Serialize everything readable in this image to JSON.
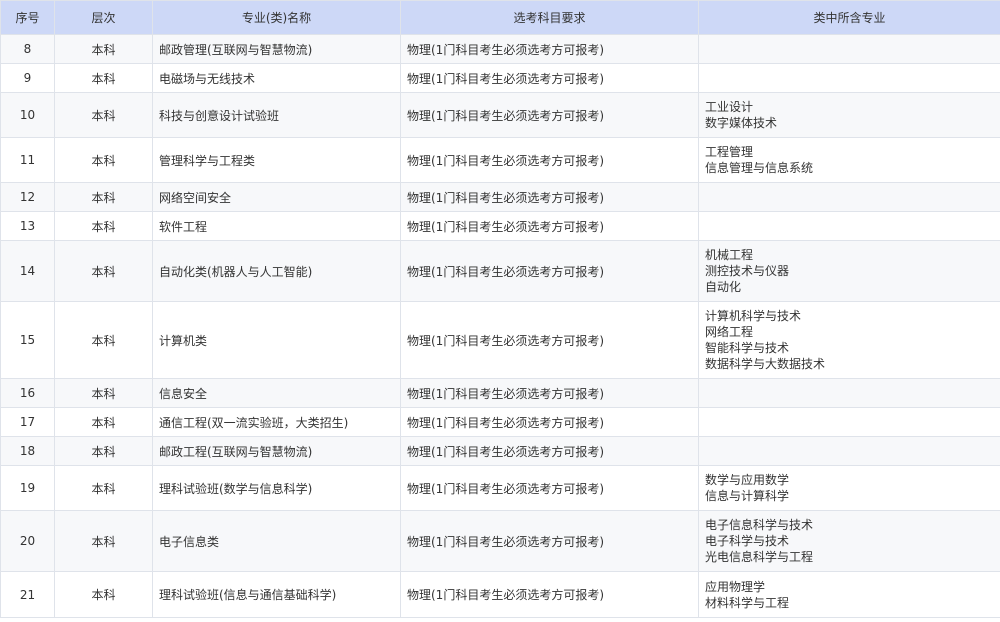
{
  "headers": [
    "序号",
    "层次",
    "专业(类)名称",
    "选考科目要求",
    "类中所含专业"
  ],
  "rows": [
    {
      "no": "8",
      "level": "本科",
      "name": "邮政管理(互联网与智慧物流)",
      "req": "物理(1门科目考生必须选考方可报考)",
      "subs": []
    },
    {
      "no": "9",
      "level": "本科",
      "name": "电磁场与无线技术",
      "req": "物理(1门科目考生必须选考方可报考)",
      "subs": []
    },
    {
      "no": "10",
      "level": "本科",
      "name": "科技与创意设计试验班",
      "req": "物理(1门科目考生必须选考方可报考)",
      "subs": [
        "工业设计",
        "数字媒体技术"
      ]
    },
    {
      "no": "11",
      "level": "本科",
      "name": "管理科学与工程类",
      "req": "物理(1门科目考生必须选考方可报考)",
      "subs": [
        "工程管理",
        "信息管理与信息系统"
      ]
    },
    {
      "no": "12",
      "level": "本科",
      "name": "网络空间安全",
      "req": "物理(1门科目考生必须选考方可报考)",
      "subs": []
    },
    {
      "no": "13",
      "level": "本科",
      "name": "软件工程",
      "req": "物理(1门科目考生必须选考方可报考)",
      "subs": []
    },
    {
      "no": "14",
      "level": "本科",
      "name": "自动化类(机器人与人工智能)",
      "req": "物理(1门科目考生必须选考方可报考)",
      "subs": [
        "机械工程",
        "测控技术与仪器",
        "自动化"
      ]
    },
    {
      "no": "15",
      "level": "本科",
      "name": "计算机类",
      "req": "物理(1门科目考生必须选考方可报考)",
      "subs": [
        "计算机科学与技术",
        "网络工程",
        "智能科学与技术",
        "数据科学与大数据技术"
      ]
    },
    {
      "no": "16",
      "level": "本科",
      "name": "信息安全",
      "req": "物理(1门科目考生必须选考方可报考)",
      "subs": []
    },
    {
      "no": "17",
      "level": "本科",
      "name": "通信工程(双一流实验班，大类招生)",
      "req": "物理(1门科目考生必须选考方可报考)",
      "subs": []
    },
    {
      "no": "18",
      "level": "本科",
      "name": "邮政工程(互联网与智慧物流)",
      "req": "物理(1门科目考生必须选考方可报考)",
      "subs": []
    },
    {
      "no": "19",
      "level": "本科",
      "name": "理科试验班(数学与信息科学)",
      "req": "物理(1门科目考生必须选考方可报考)",
      "subs": [
        "数学与应用数学",
        "信息与计算科学"
      ]
    },
    {
      "no": "20",
      "level": "本科",
      "name": "电子信息类",
      "req": "物理(1门科目考生必须选考方可报考)",
      "subs": [
        "电子信息科学与技术",
        "电子科学与技术",
        "光电信息科学与工程"
      ]
    },
    {
      "no": "21",
      "level": "本科",
      "name": "理科试验班(信息与通信基础科学)",
      "req": "物理(1门科目考生必须选考方可报考)",
      "subs": [
        "应用物理学",
        "材料科学与工程"
      ]
    }
  ]
}
